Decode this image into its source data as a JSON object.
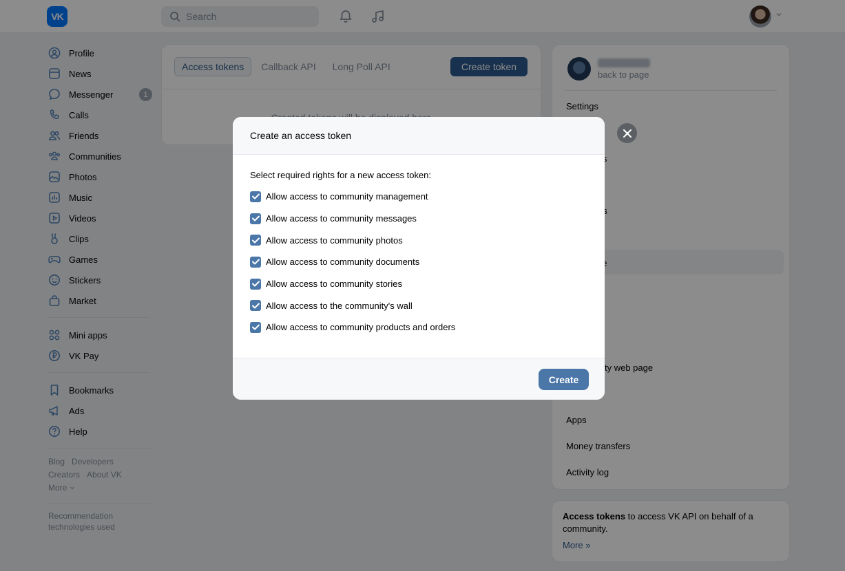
{
  "header": {
    "logo_text": "VK",
    "search_placeholder": "Search"
  },
  "sidebar": {
    "items": [
      {
        "label": "Profile",
        "icon": "user-icon"
      },
      {
        "label": "News",
        "icon": "news-icon"
      },
      {
        "label": "Messenger",
        "icon": "chat-bubble-icon",
        "badge": "1"
      },
      {
        "label": "Calls",
        "icon": "phone-icon"
      },
      {
        "label": "Friends",
        "icon": "friends-icon"
      },
      {
        "label": "Communities",
        "icon": "communities-icon"
      },
      {
        "label": "Photos",
        "icon": "photo-icon"
      },
      {
        "label": "Music",
        "icon": "music-icon"
      },
      {
        "label": "Videos",
        "icon": "video-icon"
      },
      {
        "label": "Clips",
        "icon": "clips-icon"
      },
      {
        "label": "Games",
        "icon": "gamepad-icon"
      },
      {
        "label": "Stickers",
        "icon": "smile-icon"
      },
      {
        "label": "Market",
        "icon": "bag-icon"
      }
    ],
    "items2": [
      {
        "label": "Mini apps",
        "icon": "grid-icon"
      },
      {
        "label": "VK Pay",
        "icon": "coin-icon"
      }
    ],
    "items3": [
      {
        "label": "Bookmarks",
        "icon": "bookmark-icon"
      },
      {
        "label": "Ads",
        "icon": "megaphone-icon"
      },
      {
        "label": "Help",
        "icon": "help-icon"
      }
    ],
    "footer": {
      "blog": "Blog",
      "developers": "Developers",
      "creators": "Creators",
      "about": "About VK",
      "more": "More",
      "reco_line1": "Recommendation",
      "reco_line2": "technologies used"
    }
  },
  "main": {
    "tabs": [
      "Access tokens",
      "Callback API",
      "Long Poll API"
    ],
    "create_token": "Create token",
    "empty_text": "Created tokens will be displayed here"
  },
  "right": {
    "back_to_page": "back to page",
    "menu": {
      "settings": "Settings",
      "partial_1": "nts",
      "partial_2": "es",
      "partial_3": "ge",
      "partial_4": "s",
      "partial_5": "ty web page",
      "apps": "Apps",
      "money_transfers": "Money transfers",
      "activity_log": "Activity log"
    },
    "info": {
      "bold": "Access tokens",
      "text": " to access VK API on behalf of a community.",
      "more": "More »"
    }
  },
  "modal": {
    "title": "Create an access token",
    "subtitle": "Select required rights for a new access token:",
    "options": [
      "Allow access to community management",
      "Allow access to community messages",
      "Allow access to community photos",
      "Allow access to community documents",
      "Allow access to community stories",
      "Allow access to the community's wall",
      "Allow access to community products and orders"
    ],
    "create_label": "Create"
  },
  "colors": {
    "accent": "#4a76a8",
    "vk_blue": "#0077ff",
    "overlay": "rgba(0,0,0,0.45)"
  }
}
